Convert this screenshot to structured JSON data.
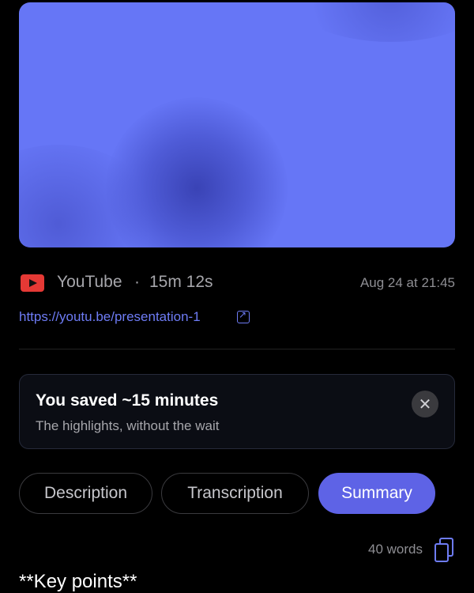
{
  "video": {
    "source": "YouTube",
    "separator": "·",
    "duration": "15m 12s",
    "date": "Aug 24 at 21:45",
    "url": "https://youtu.be/presentation-1"
  },
  "saved_card": {
    "title": "You saved ~15 minutes",
    "subtitle": "The highlights, without the wait",
    "close_label": "✕"
  },
  "tabs": [
    {
      "label": "Description"
    },
    {
      "label": "Transcription"
    },
    {
      "label": "Summary",
      "active": true
    }
  ],
  "word_count": "40 words",
  "summary_text": "**Key points**",
  "colors": {
    "background": "#000000",
    "accent": "#5e63e6",
    "link": "#6e7cf5",
    "youtube_red": "#e53935",
    "thumbnail": "#6676f6"
  },
  "icons": [
    "youtube-icon",
    "external-link-icon",
    "close-icon",
    "copy-icon"
  ]
}
